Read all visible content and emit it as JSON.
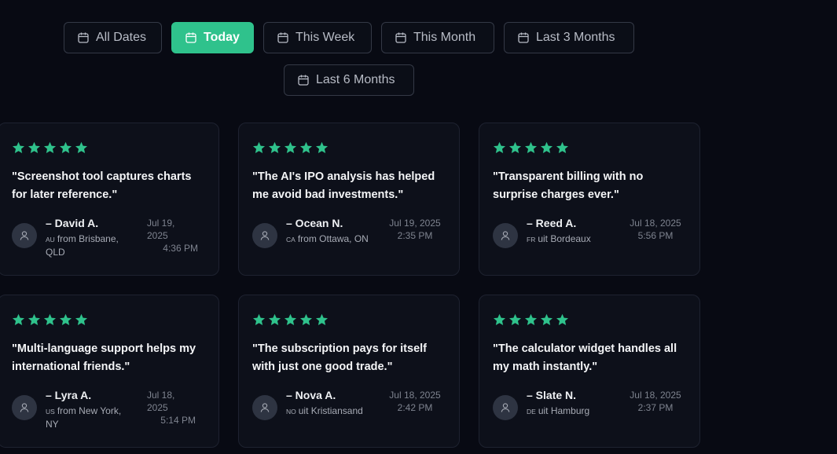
{
  "filters": {
    "items": [
      {
        "label": "All Dates",
        "active": false
      },
      {
        "label": "Today",
        "active": true
      },
      {
        "label": "This Week",
        "active": false
      },
      {
        "label": "This Month",
        "active": false
      },
      {
        "label": "Last 3 Months",
        "active": false
      },
      {
        "label": "Last 6 Months",
        "active": false
      }
    ],
    "icon": "calendar-icon"
  },
  "colors": {
    "accent": "#2fc28c",
    "background": "#080a13",
    "card": "#0d101a",
    "star": "#2fc28c"
  },
  "reviews": [
    {
      "rating": 5,
      "quote": "\"Screenshot tool captures charts for later reference.\"",
      "name": "– David A.",
      "country": "AU",
      "location": "from Brisbane, QLD",
      "date": "Jul 19, 2025",
      "time": "4:36 PM"
    },
    {
      "rating": 5,
      "quote": "\"The AI's IPO analysis has helped me avoid bad investments.\"",
      "name": "– Ocean N.",
      "country": "CA",
      "location": "from Ottawa, ON",
      "date": "Jul 19, 2025",
      "time": "2:35 PM"
    },
    {
      "rating": 5,
      "quote": "\"Transparent billing with no surprise charges ever.\"",
      "name": "– Reed A.",
      "country": "FR",
      "location": "uit Bordeaux",
      "date": "Jul 18, 2025",
      "time": "5:56 PM"
    },
    {
      "rating": 5,
      "quote": "\"Multi-language support helps my international friends.\"",
      "name": "– Lyra A.",
      "country": "US",
      "location": "from New York, NY",
      "date": "Jul 18, 2025",
      "time": "5:14 PM"
    },
    {
      "rating": 5,
      "quote": "\"The subscription pays for itself with just one good trade.\"",
      "name": "– Nova A.",
      "country": "NO",
      "location": "uit Kristiansand",
      "date": "Jul 18, 2025",
      "time": "2:42 PM"
    },
    {
      "rating": 5,
      "quote": "\"The calculator widget handles all my math instantly.\"",
      "name": "– Slate N.",
      "country": "DE",
      "location": "uit Hamburg",
      "date": "Jul 18, 2025",
      "time": "2:37 PM"
    }
  ]
}
